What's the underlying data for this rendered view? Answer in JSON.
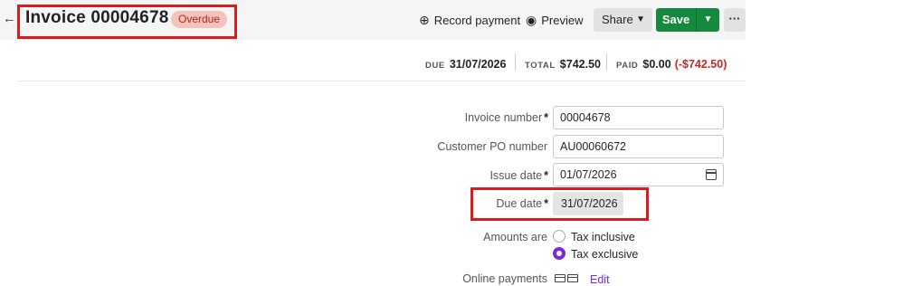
{
  "header": {
    "back_icon": "arrow-left-icon",
    "title": "Invoice 00004678",
    "status": "Overdue",
    "actions": {
      "record_payment": "Record payment",
      "preview": "Preview",
      "share": "Share",
      "save": "Save",
      "more": "···"
    }
  },
  "summary": {
    "due_label": "DUE",
    "due_value": "31/07/2026",
    "total_label": "TOTAL",
    "total_value": "$742.50",
    "paid_label": "PAID",
    "paid_value": "$0.00",
    "paid_diff": "(-$742.50)"
  },
  "form": {
    "invoice_number": {
      "label": "Invoice number",
      "value": "00004678"
    },
    "customer_po": {
      "label": "Customer PO number",
      "value": "AU00060672"
    },
    "issue_date": {
      "label": "Issue date",
      "value": "01/07/2026"
    },
    "due_date": {
      "label": "Due date",
      "value": "31/07/2026"
    },
    "amounts": {
      "label": "Amounts are",
      "options": [
        "Tax inclusive",
        "Tax exclusive"
      ],
      "selected": "Tax exclusive"
    },
    "online_payments": {
      "label": "Online payments",
      "edit": "Edit"
    },
    "required_mark": "*"
  },
  "colors": {
    "accent": "#7b2bd8",
    "save": "#148a3c",
    "overdue_bg": "#f6c2be",
    "overdue_text": "#b3261e",
    "highlight": "#e0191c",
    "negative": "#c62828"
  }
}
